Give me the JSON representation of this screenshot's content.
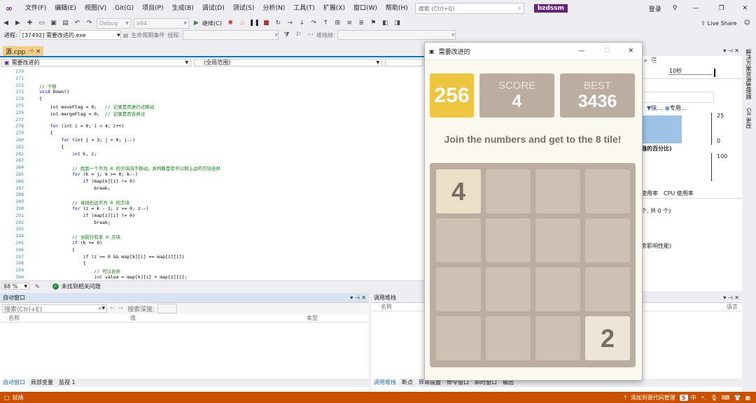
{
  "menubar": {
    "items": [
      "文件(F)",
      "编辑(E)",
      "视图(V)",
      "Git(G)",
      "项目(P)",
      "生成(B)",
      "调试(D)",
      "测试(S)",
      "分析(N)",
      "工具(T)",
      "扩展(X)",
      "窗口(W)",
      "帮助(H)"
    ],
    "search_placeholder": "搜索 (Ctrl+Q)",
    "solution": "bzdssm",
    "login": "登录",
    "live_share": "Live Share"
  },
  "toolbar": {
    "config": "Debug",
    "platform": "x64",
    "continue": "继续(C)"
  },
  "procbar": {
    "process_label": "进程:",
    "process_value": "[37492] 需要改进的.exe",
    "lifecycle": "生命周期事件",
    "thread_label": "线程:",
    "stack_label": "堆栈帧:"
  },
  "editor": {
    "tab": "源.cpp",
    "nav_project": "需要改进的",
    "nav_scope": "(全局范围)",
    "zoom": "88 %",
    "status": "未找到相关问题",
    "lines": [
      {
        "n": "270",
        "code": ""
      },
      {
        "n": "271",
        "code": ""
      },
      {
        "n": "272",
        "code": "// 下移"
      },
      {
        "n": "273",
        "code": "void Down()"
      },
      {
        "n": "274",
        "code": "{"
      },
      {
        "n": "275",
        "code": "    int moveFlag = 0;   // 记录是否进行过移动"
      },
      {
        "n": "276",
        "code": "    int mergeFlag = 0;  // 记录是否合并过"
      },
      {
        "n": "277",
        "code": ""
      },
      {
        "n": "278",
        "code": "    for (int i = 0; i < 4; i++)"
      },
      {
        "n": "279",
        "code": "    {"
      },
      {
        "n": "280",
        "code": "        for (int j = 3; j > 0; j--)"
      },
      {
        "n": "281",
        "code": "        {"
      },
      {
        "n": "282",
        "code": "            int k, z;"
      },
      {
        "n": "283",
        "code": ""
      },
      {
        "n": "284",
        "code": "            // 找到一个不为 0 的方块向下移动，并判断是否可以和上边的方块合并"
      },
      {
        "n": "285",
        "code": "            for (k = j; k >= 0; k--)"
      },
      {
        "n": "286",
        "code": "                if (map[k][i] != 0)"
      },
      {
        "n": "287",
        "code": "                    break;"
      },
      {
        "n": "288",
        "code": ""
      },
      {
        "n": "289",
        "code": "            // 寻找右边不为 0 的方块"
      },
      {
        "n": "290",
        "code": "            for (z = k - 1; z >= 0; z--)"
      },
      {
        "n": "291",
        "code": "                if (map[z][i] != 0)"
      },
      {
        "n": "292",
        "code": "                    break;"
      },
      {
        "n": "293",
        "code": ""
      },
      {
        "n": "294",
        "code": "            // 当前行有非 0 方块"
      },
      {
        "n": "295",
        "code": "            if (k >= 0)"
      },
      {
        "n": "296",
        "code": "            {"
      },
      {
        "n": "297",
        "code": "                if (z >= 0 && map[k][i] == map[z][i])"
      },
      {
        "n": "298",
        "code": "                {"
      },
      {
        "n": "299",
        "code": "                    // 可以合并"
      },
      {
        "n": "300",
        "code": "                    int value = map[k][i] + map[z][i];"
      }
    ]
  },
  "autos": {
    "title": "自动窗口",
    "search_placeholder": "搜索(Ctrl+E)",
    "search_depth": "搜索深度:",
    "cols": [
      "名称",
      "值",
      "类型"
    ],
    "tabs": [
      "自动窗口",
      "局部变量",
      "监视 1"
    ]
  },
  "callstack": {
    "title": "调用堆栈",
    "cols": [
      "名称",
      "语言"
    ],
    "tabs": [
      "调用堆栈",
      "断点",
      "异常设置",
      "命令窗口",
      "即时窗口",
      "输出"
    ]
  },
  "diagnostics": {
    "time": "10秒",
    "legend": [
      "快...",
      "专用..."
    ],
    "axis_top": "25",
    "axis_zero": "0",
    "axis_100": "100",
    "percent_label": "器的百分比)",
    "usage_tabs": [
      "使用率",
      "CPU 使用率"
    ],
    "count_text": "个, 共 0 个)",
    "note": "余影响性能)"
  },
  "side_tabs": [
    "解决方案资源管理器",
    "Git 更改"
  ],
  "statusbar": {
    "ready": "就绪",
    "source_control": "添加到源代码管理",
    "ime": "中"
  },
  "game": {
    "window_title": "需要改进的",
    "logo": "256",
    "score_label": "SCORE",
    "score": "4",
    "best_label": "BEST",
    "best": "3436",
    "message": "Join the numbers and get to the 8 tile!",
    "board": [
      [
        "4",
        "",
        "",
        ""
      ],
      [
        "",
        "",
        "",
        ""
      ],
      [
        "",
        "",
        "",
        ""
      ],
      [
        "",
        "",
        "",
        "2"
      ]
    ],
    "colors": {
      "logo_bg": "#edc53f",
      "score_bg": "#bbada0",
      "board_bg": "#bbada0",
      "cell_empty": "#cdc1b4",
      "tile_2": "#eee4da",
      "tile_4": "#ede0c8"
    }
  }
}
